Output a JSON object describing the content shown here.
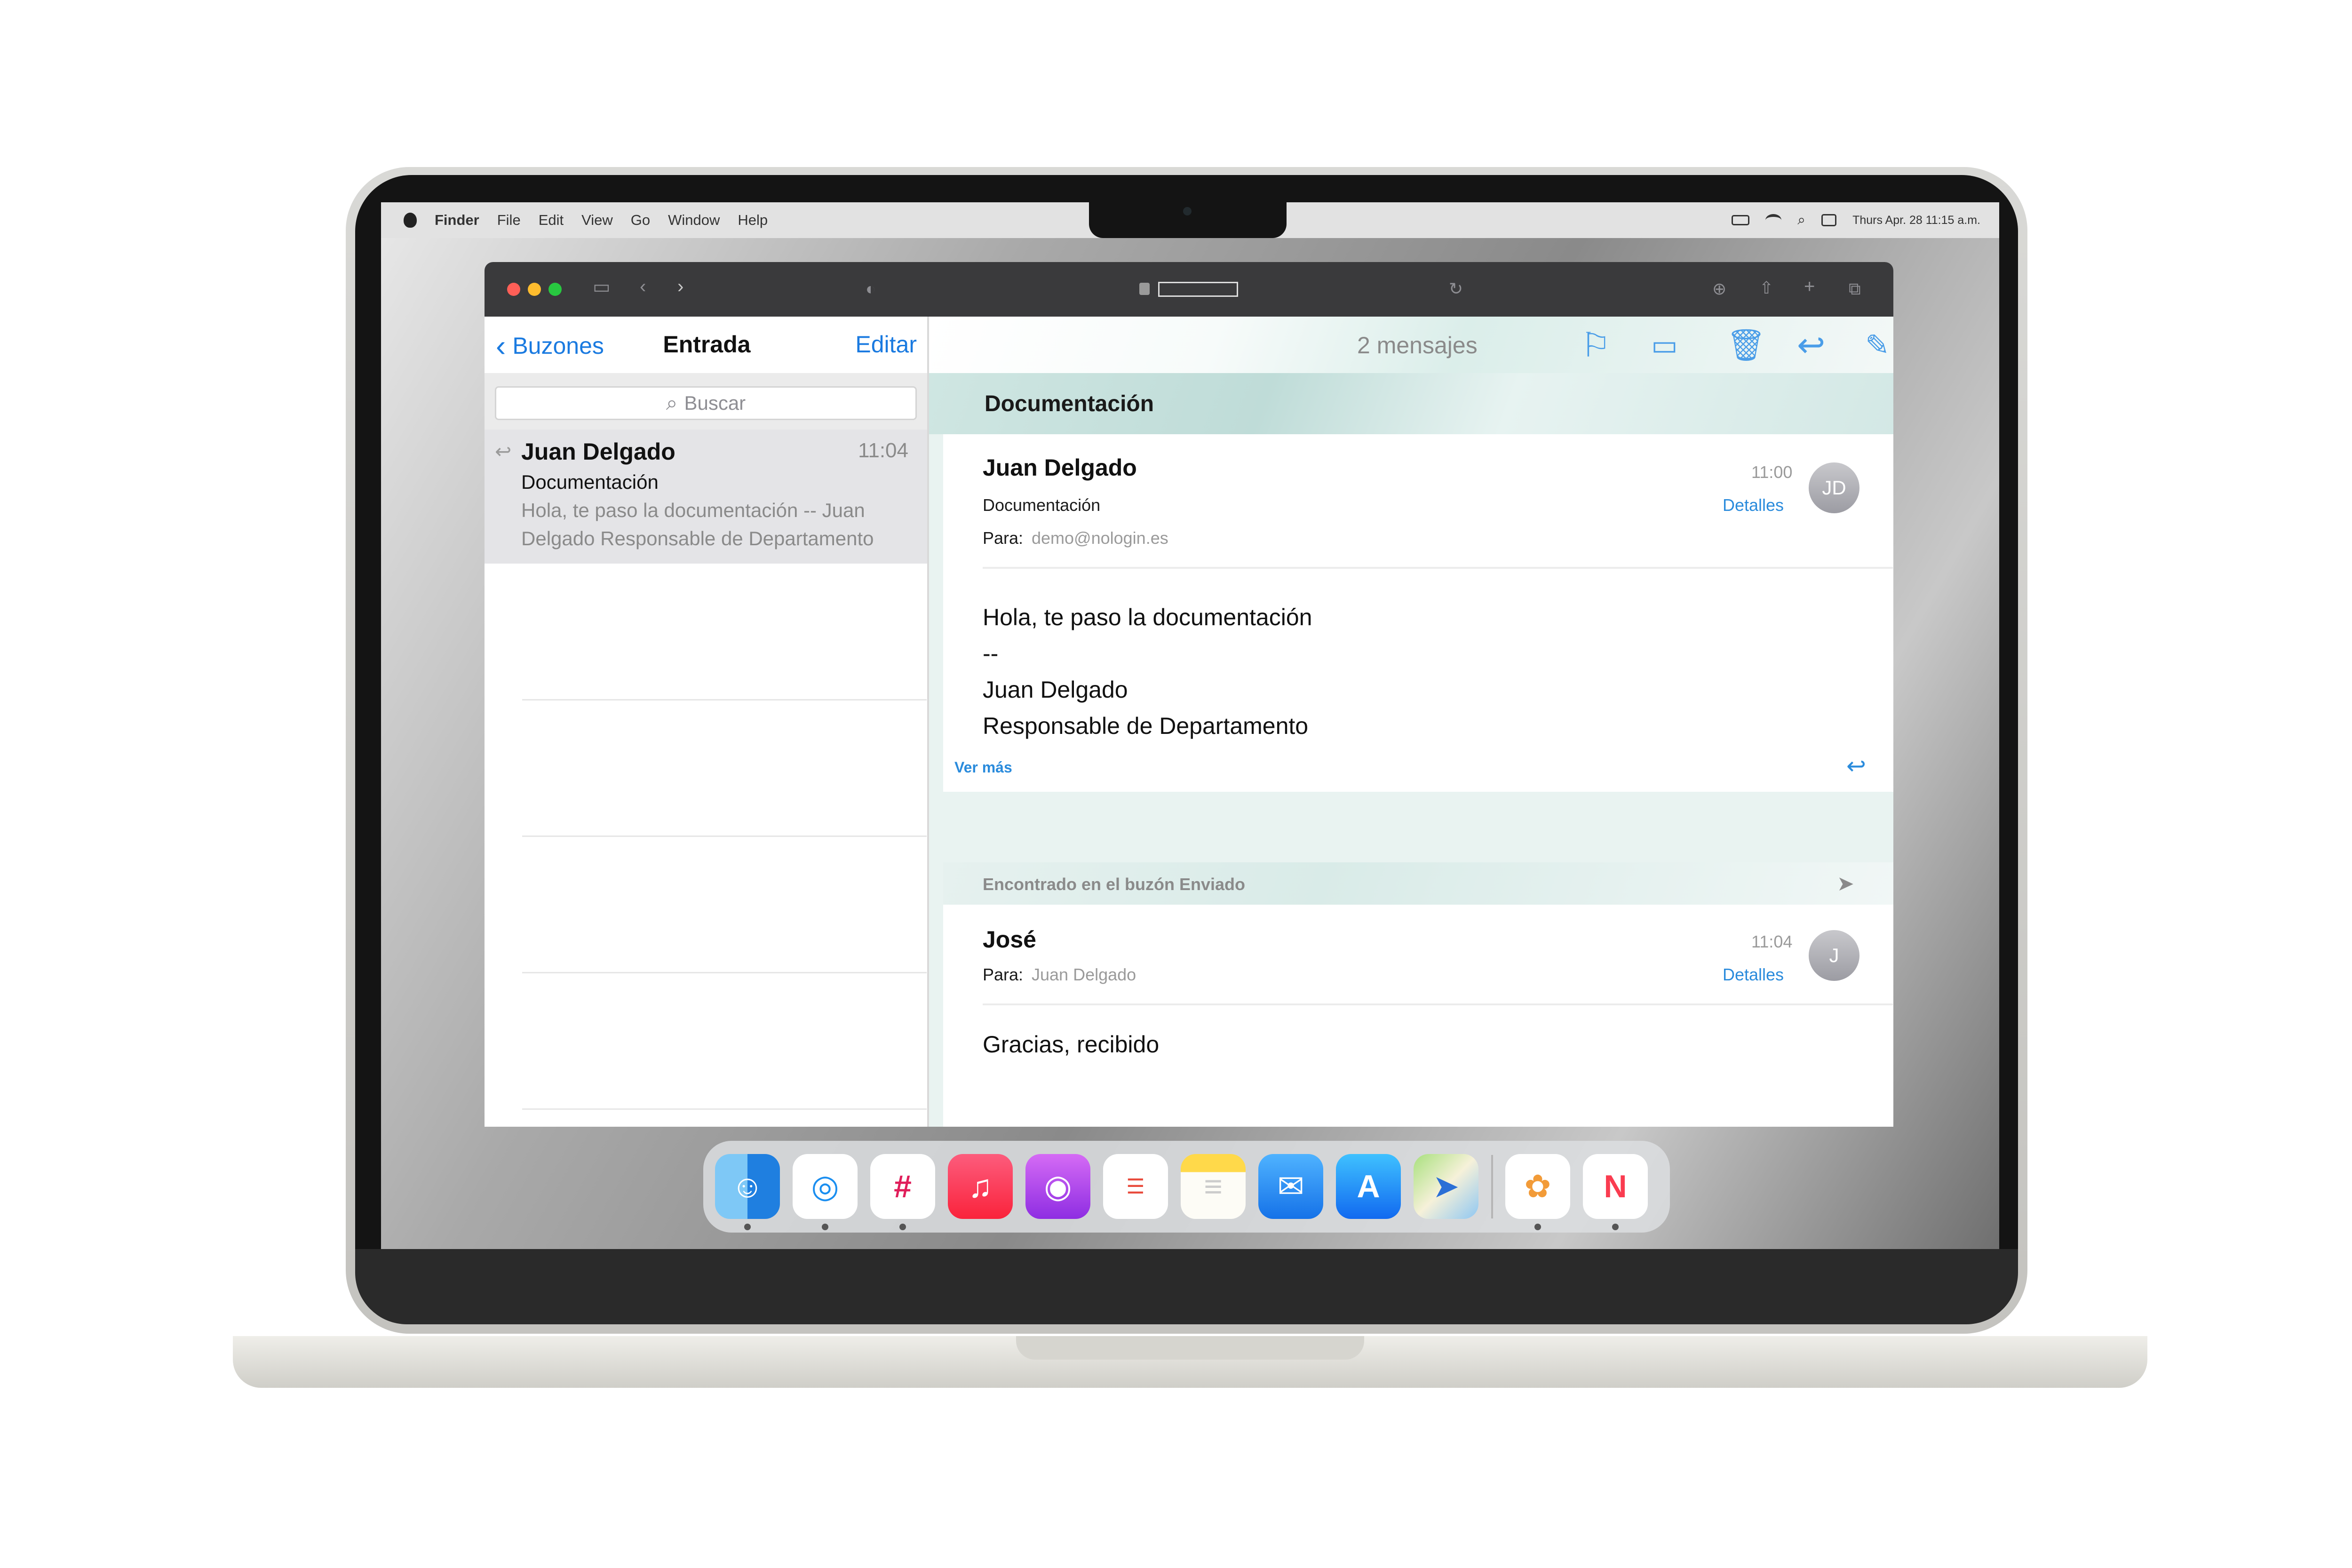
{
  "menubar": {
    "app_name": "Finder",
    "items": [
      "File",
      "Edit",
      "View",
      "Go",
      "Window",
      "Help"
    ],
    "datetime": "Thurs Apr. 28 11:15 a.m."
  },
  "mail": {
    "list": {
      "back_label": "Buzones",
      "title": "Entrada",
      "edit_label": "Editar",
      "search_placeholder": "Buscar",
      "messages": [
        {
          "sender": "Juan Delgado",
          "time": "11:04",
          "subject": "Documentación",
          "preview_line1": "Hola, te paso la documentación -- Juan",
          "preview_line2": "Delgado Responsable de Departamento"
        }
      ]
    },
    "reader": {
      "message_count": "2 mensajes",
      "subject": "Documentación",
      "first": {
        "sender": "Juan Delgado",
        "subject": "Documentación",
        "to_label": "Para:",
        "to": "demo@nologin.es",
        "time": "11:00",
        "details": "Detalles",
        "avatar": "JD",
        "body": [
          "Hola, te paso la documentación",
          "--",
          "Juan Delgado",
          "Responsable de Departamento"
        ],
        "see_more": "Ver más"
      },
      "found_in": "Encontrado en el buzón Enviado",
      "second": {
        "sender": "José",
        "to_label": "Para:",
        "to": "Juan Delgado",
        "time": "11:04",
        "details": "Detalles",
        "avatar": "J",
        "body": "Gracias, recibido"
      }
    }
  },
  "dock": {
    "apps": [
      "finder-icon",
      "safari-icon",
      "slack-icon",
      "music-icon",
      "podcasts-icon",
      "reminders-icon",
      "notes-icon",
      "mail-icon",
      "app-store-icon",
      "maps-icon",
      "photos-icon",
      "news-icon"
    ]
  },
  "colors": {
    "accent_blue": "#1a7ae0",
    "traffic_red": "#ff5f57",
    "traffic_yellow": "#febc2e",
    "traffic_green": "#28c840"
  }
}
